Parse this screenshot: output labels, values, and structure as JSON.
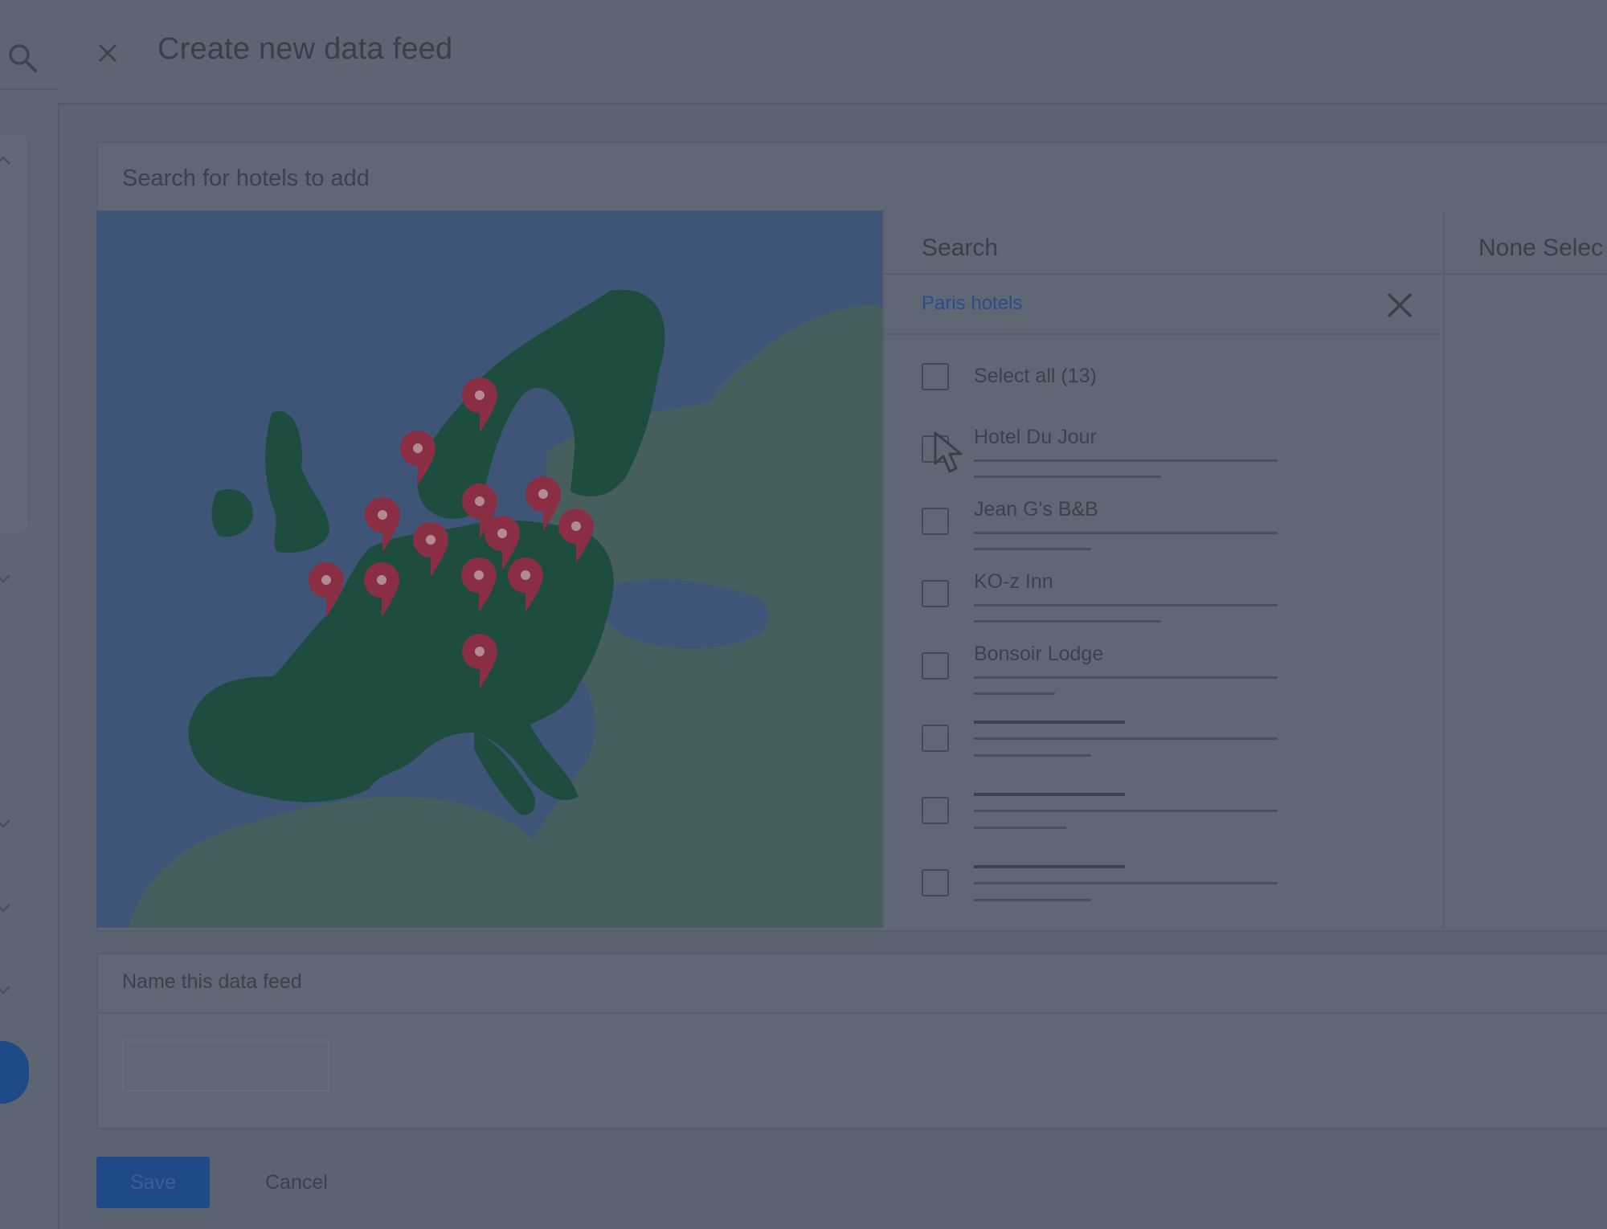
{
  "header": {
    "title": "Create new data feed"
  },
  "hotel_search": {
    "heading": "Search for hotels to add",
    "search_label": "Search",
    "query": "Paris hotels",
    "selected_header": "None Selec",
    "select_all": "Select all (13)",
    "results": [
      {
        "name": "Hotel Du Jour"
      },
      {
        "name": "Jean G's B&B"
      },
      {
        "name": "KO-z  Inn"
      },
      {
        "name": "Bonsoir Lodge"
      }
    ]
  },
  "name_feed": {
    "label": "Name this data feed",
    "value": "",
    "placeholder": ""
  },
  "actions": {
    "save": "Save",
    "cancel": "Cancel"
  },
  "colors": {
    "overlay_bg": "#5b6270",
    "map_sea": "#3f5577",
    "map_land_selected": "#1e4d40",
    "map_land_other": "#475e5e",
    "pin": "#8a2f43",
    "primary_button": "#1e4a8a",
    "link": "#2a4d8a"
  },
  "icons": {
    "rail_search": "search-icon",
    "close": "close-icon",
    "clear": "close-icon",
    "map_pin": "map-pin-icon",
    "cursor": "mouse-cursor-icon"
  }
}
